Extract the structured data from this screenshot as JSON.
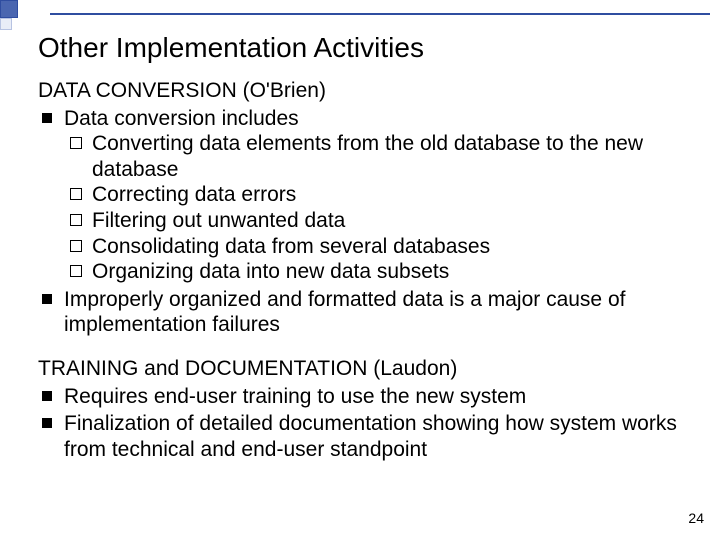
{
  "slide": {
    "title": "Other Implementation Activities",
    "page_number": "24",
    "sections": [
      {
        "heading": "DATA CONVERSION (O'Brien)",
        "bullets": [
          {
            "text": "Data conversion includes",
            "sub": [
              "Converting data elements from the old database to the new database",
              "Correcting data errors",
              "Filtering out unwanted data",
              "Consolidating data from several databases",
              "Organizing data into new data subsets"
            ]
          },
          {
            "text": "Improperly organized and formatted data is a major cause of implementation failures",
            "sub": []
          }
        ]
      },
      {
        "heading": "TRAINING and DOCUMENTATION (Laudon)",
        "bullets": [
          {
            "text": "Requires end-user training to use the new system",
            "sub": []
          },
          {
            "text": "Finalization of detailed documentation showing how system works from technical and end-user standpoint",
            "sub": []
          }
        ]
      }
    ]
  }
}
